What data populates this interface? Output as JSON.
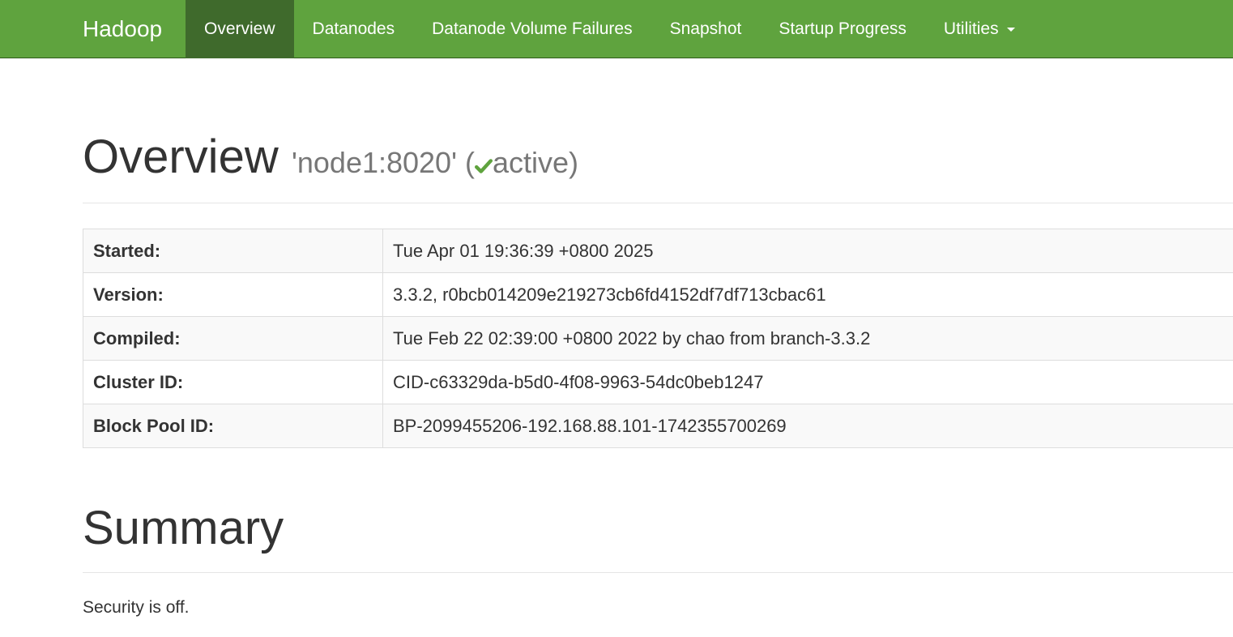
{
  "navbar": {
    "brand": "Hadoop",
    "items": [
      {
        "label": "Overview"
      },
      {
        "label": "Datanodes"
      },
      {
        "label": "Datanode Volume Failures"
      },
      {
        "label": "Snapshot"
      },
      {
        "label": "Startup Progress"
      },
      {
        "label": "Utilities"
      }
    ],
    "accent_color": "#5fa33e",
    "active_color": "#3f6a2c"
  },
  "overview": {
    "title": "Overview",
    "node": "'node1:8020'",
    "status_open": "(",
    "status": "active)",
    "status_icon": "check-icon",
    "status_icon_color": "#5fa33e"
  },
  "info_table": [
    {
      "label": "Started:",
      "value": "Tue Apr 01 19:36:39 +0800 2025"
    },
    {
      "label": "Version:",
      "value": "3.3.2, r0bcb014209e219273cb6fd4152df7df713cbac61"
    },
    {
      "label": "Compiled:",
      "value": "Tue Feb 22 02:39:00 +0800 2022 by chao from branch-3.3.2"
    },
    {
      "label": "Cluster ID:",
      "value": "CID-c63329da-b5d0-4f08-9963-54dc0beb1247"
    },
    {
      "label": "Block Pool ID:",
      "value": "BP-2099455206-192.168.88.101-1742355700269"
    }
  ],
  "summary": {
    "title": "Summary",
    "security": "Security is off."
  }
}
